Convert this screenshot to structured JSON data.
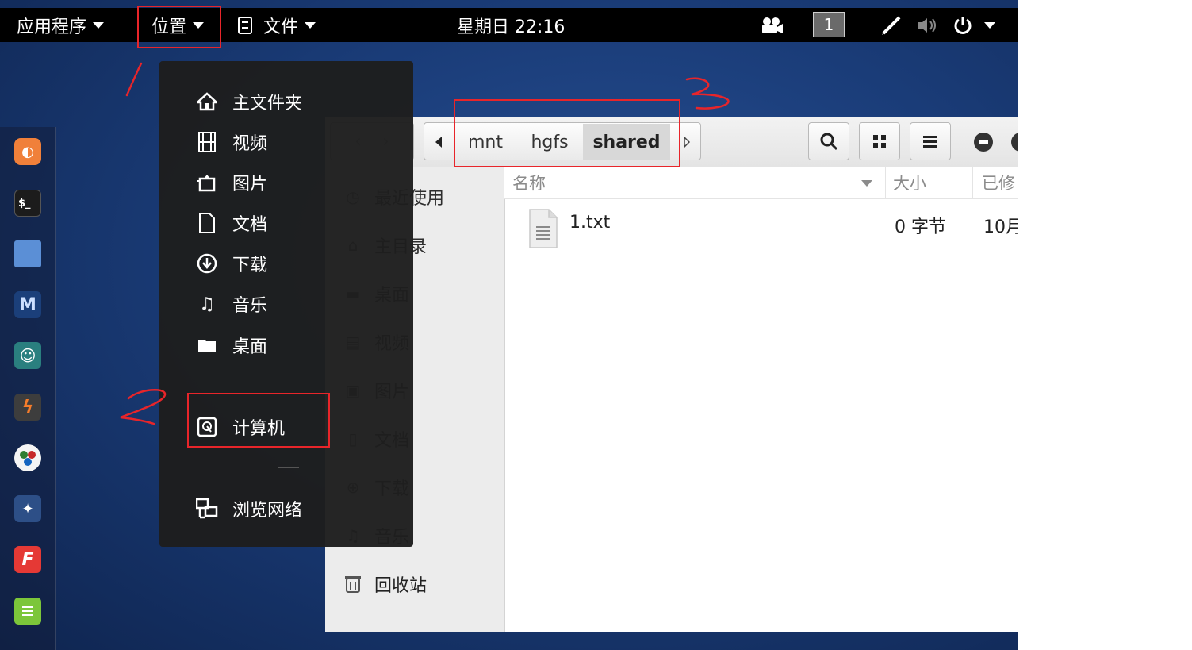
{
  "topbar": {
    "applications": "应用程序",
    "places": "位置",
    "files": "文件",
    "clock": "星期日 22:16",
    "workspace": "1"
  },
  "places_menu": {
    "items": [
      {
        "label": "主文件夹",
        "icon": "home-icon"
      },
      {
        "label": "视频",
        "icon": "film-icon"
      },
      {
        "label": "图片",
        "icon": "picture-icon"
      },
      {
        "label": "文档",
        "icon": "document-icon"
      },
      {
        "label": "下载",
        "icon": "download-icon"
      },
      {
        "label": "音乐",
        "icon": "music-icon"
      },
      {
        "label": "桌面",
        "icon": "folder-icon"
      }
    ],
    "computer": "计算机",
    "network": "浏览网络"
  },
  "file_manager": {
    "breadcrumb": [
      "mnt",
      "hgfs",
      "shared"
    ],
    "sidebar": [
      "最近使用",
      "主目录",
      "桌面",
      "视频",
      "图片",
      "文档",
      "下载",
      "音乐"
    ],
    "trash": "回收站",
    "columns": {
      "name": "名称",
      "size": "大小",
      "modified": "已修"
    },
    "files": [
      {
        "name": "1.txt",
        "size": "0 字节",
        "modified": "10月"
      }
    ]
  },
  "colors": {
    "annotation": "#e8252a",
    "topbar": "#000000",
    "menu": "#1e1e1e",
    "desktop": "#1a3c78"
  }
}
